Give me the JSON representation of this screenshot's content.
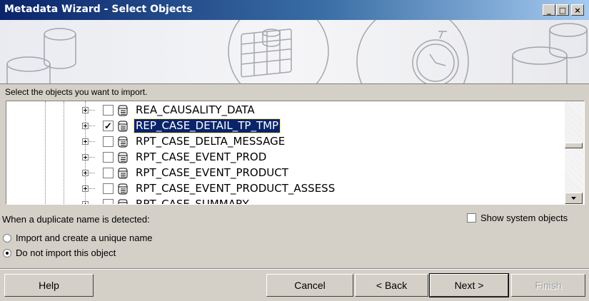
{
  "window": {
    "title": "Metadata Wizard - Select Objects",
    "controls": [
      "_",
      "□",
      "×"
    ]
  },
  "prompt": "Select the objects you want to import.",
  "tree": {
    "rows": [
      {
        "label": "REA_CAUSALITY_DATA",
        "checked": false,
        "selected": false
      },
      {
        "label": "REP_CASE_DETAIL_TP_TMP",
        "checked": true,
        "selected": true
      },
      {
        "label": "RPT_CASE_DELTA_MESSAGE",
        "checked": false,
        "selected": false
      },
      {
        "label": "RPT_CASE_EVENT_PROD",
        "checked": false,
        "selected": false
      },
      {
        "label": "RPT_CASE_EVENT_PRODUCT",
        "checked": false,
        "selected": false
      },
      {
        "label": "RPT_CASE_EVENT_PRODUCT_ASSESS",
        "checked": false,
        "selected": false
      },
      {
        "label": "RPT_CASE_SUMMARY",
        "checked": false,
        "selected": false
      }
    ]
  },
  "duplicate": {
    "label": "When a duplicate name is detected:",
    "options": [
      {
        "label": "Import and create a unique name",
        "selected": false
      },
      {
        "label": "Do not import this object",
        "selected": true
      }
    ]
  },
  "show_system": {
    "label": "Show system objects",
    "checked": false
  },
  "buttons": {
    "help": "Help",
    "cancel": "Cancel",
    "back": "< Back",
    "next": "Next >",
    "finish": "Finish"
  }
}
